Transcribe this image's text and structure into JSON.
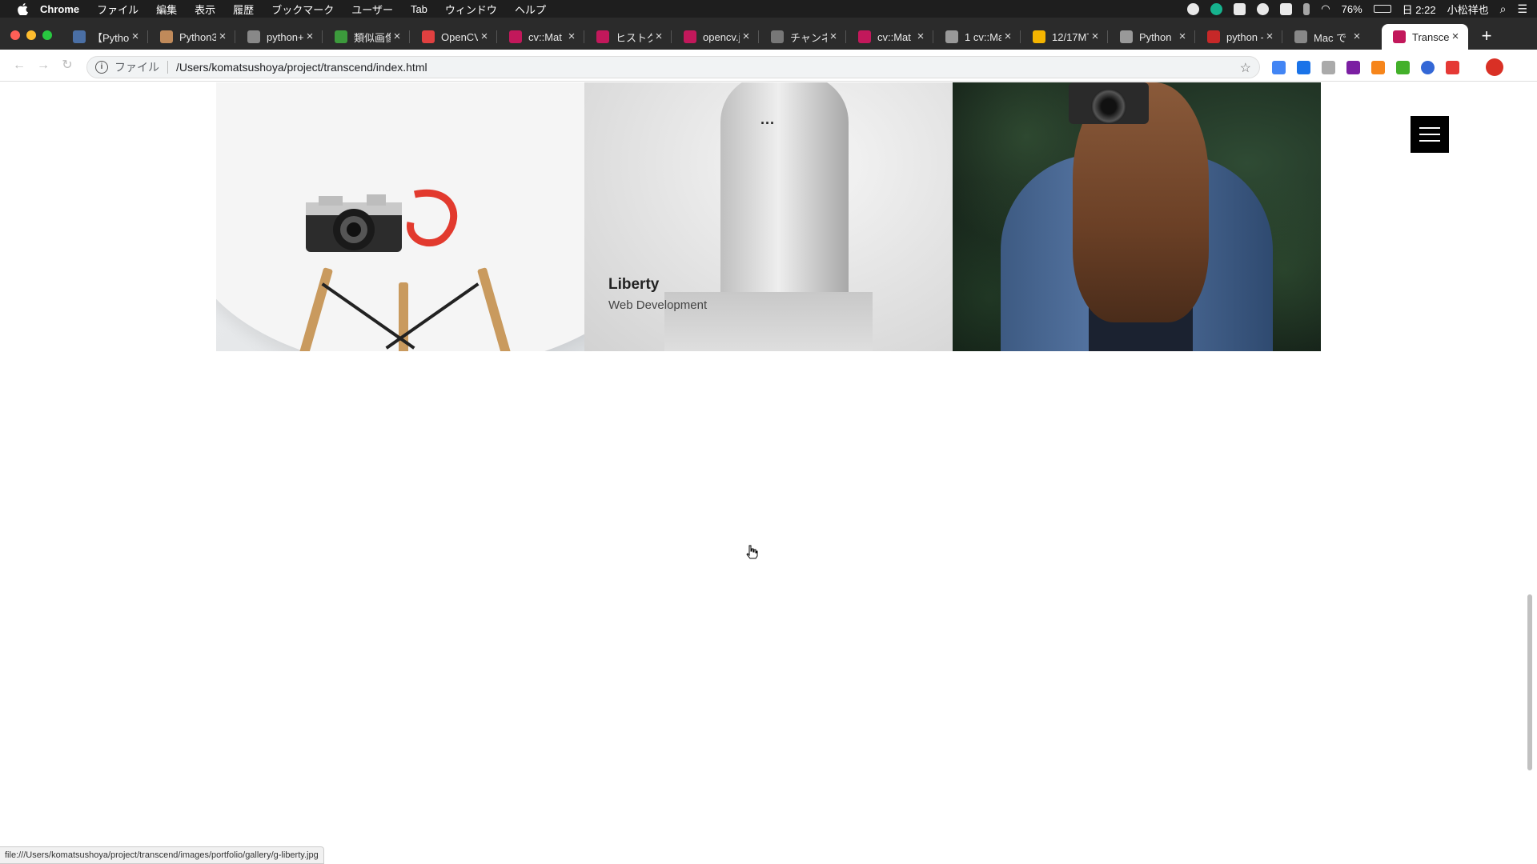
{
  "menubar": {
    "app": "Chrome",
    "items": [
      "ファイル",
      "編集",
      "表示",
      "履歴",
      "ブックマーク",
      "ユーザー",
      "Tab",
      "ウィンドウ",
      "ヘルプ"
    ],
    "battery": "76%",
    "clock": "日 2:22",
    "user": "小松祥也"
  },
  "tabs": [
    {
      "title": "【Pytho",
      "fav_color": "#4a6fa5"
    },
    {
      "title": "Python3",
      "fav_color": "#c08a5a"
    },
    {
      "title": "python+",
      "fav_color": "#888888"
    },
    {
      "title": "類似画像",
      "fav_color": "#3c9a3c"
    },
    {
      "title": "OpenCV",
      "fav_color": "#e04040"
    },
    {
      "title": "cv::Mat",
      "fav_color": "#c2185b"
    },
    {
      "title": "ヒストグ",
      "fav_color": "#c2185b"
    },
    {
      "title": "opencv.j",
      "fav_color": "#c2185b"
    },
    {
      "title": "チャンネ",
      "fav_color": "#777777"
    },
    {
      "title": "cv::Mat",
      "fav_color": "#c2185b"
    },
    {
      "title": "1 cv::Ma",
      "fav_color": "#999999"
    },
    {
      "title": "12/17MT",
      "fav_color": "#f4b400"
    },
    {
      "title": "Python",
      "fav_color": "#999999"
    },
    {
      "title": "python -",
      "fav_color": "#c62828"
    },
    {
      "title": "Mac で",
      "fav_color": "#888888"
    },
    {
      "title": "Transce",
      "fav_color": "#c2185b",
      "active": true
    }
  ],
  "toolbar": {
    "scheme_label": "ファイル",
    "url": "/Users/komatsushoya/project/transcend/index.html"
  },
  "gallery": {
    "items": [
      {
        "name": "chair-camera"
      },
      {
        "name": "liberty",
        "title": "Liberty",
        "subtitle": "Web Development",
        "more": "..."
      },
      {
        "name": "woman-camera"
      }
    ]
  },
  "statusbar": {
    "text": "file:///Users/komatsushoya/project/transcend/images/portfolio/gallery/g-liberty.jpg"
  }
}
